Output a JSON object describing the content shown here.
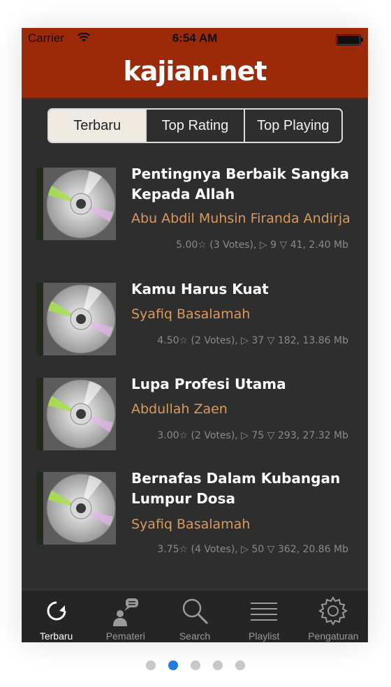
{
  "status": {
    "carrier": "Carrier",
    "time": "6:54 AM"
  },
  "app": {
    "logo": "kajian.net",
    "accent_color": "#9c2a08",
    "author_color": "#d99a5e"
  },
  "segments": [
    {
      "label": "Terbaru",
      "active": true
    },
    {
      "label": "Top Rating",
      "active": false
    },
    {
      "label": "Top Playing",
      "active": false
    }
  ],
  "items": [
    {
      "title": "Pentingnya Berbaik Sangka Kepada Allah",
      "author": "Abu Abdil Muhsin Firanda Andirja",
      "meta": "5.00☆ (3 Votes), ▷ 9 ▽ 41, 2.40 Mb",
      "icon": "cd-disc-icon"
    },
    {
      "title": "Kamu Harus Kuat",
      "author": "Syafiq Basalamah",
      "meta": "4.50☆ (2 Votes), ▷ 37 ▽ 182, 13.86 Mb",
      "icon": "cd-disc-icon"
    },
    {
      "title": "Lupa Profesi Utama",
      "author": "Abdullah Zaen",
      "meta": "3.00☆ (2 Votes), ▷ 75 ▽ 293, 27.32 Mb",
      "icon": "cd-disc-icon"
    },
    {
      "title": "Bernafas Dalam Kubangan Lumpur Dosa",
      "author": "Syafiq Basalamah",
      "meta": "3.75☆ (4 Votes), ▷ 50 ▽ 362, 20.86 Mb",
      "icon": "cd-disc-icon"
    }
  ],
  "tabs": [
    {
      "label": "Terbaru",
      "icon": "refresh-icon",
      "active": true
    },
    {
      "label": "Pemateri",
      "icon": "speaker-person-icon",
      "active": false
    },
    {
      "label": "Search",
      "icon": "search-icon",
      "active": false
    },
    {
      "label": "Playlist",
      "icon": "list-icon",
      "active": false
    },
    {
      "label": "Pengaturan",
      "icon": "gear-icon",
      "active": false
    }
  ],
  "pager": {
    "total": 5,
    "current_index": 1
  }
}
